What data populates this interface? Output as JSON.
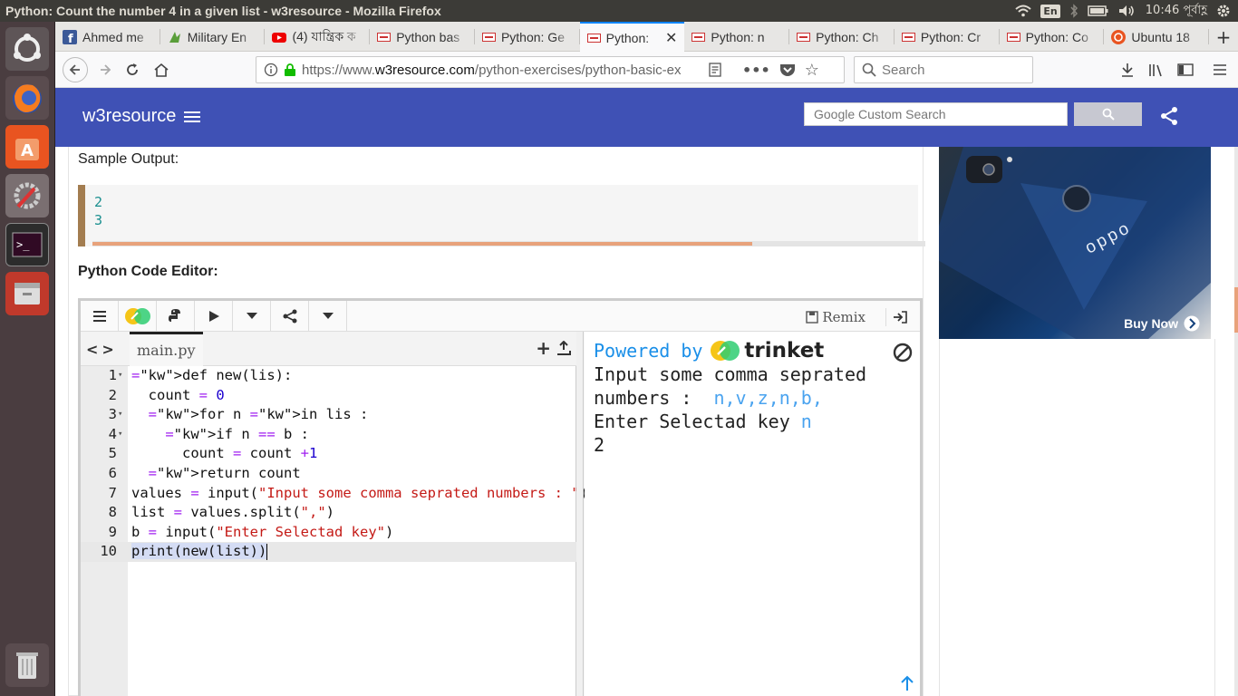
{
  "window": {
    "title": "Python: Count the number 4 in a given list - w3resource - Mozilla Firefox"
  },
  "tray": {
    "keyboard": "En",
    "time": "10:46 পূর্বাহ্ণ"
  },
  "tabs": [
    {
      "label": "Ahmed me",
      "favicon": "facebook-icon"
    },
    {
      "label": "Military En",
      "favicon": "leaf-icon"
    },
    {
      "label": "(4) যান্ত্রিক ক",
      "favicon": "youtube-icon"
    },
    {
      "label": "Python bas",
      "favicon": "w3resource-icon"
    },
    {
      "label": "Python: Ge",
      "favicon": "w3resource-icon"
    },
    {
      "label": "Python:",
      "favicon": "w3resource-icon",
      "active": true
    },
    {
      "label": "Python: n",
      "favicon": "w3resource-icon"
    },
    {
      "label": "Python: Ch",
      "favicon": "w3resource-icon"
    },
    {
      "label": "Python: Cr",
      "favicon": "w3resource-icon"
    },
    {
      "label": "Python: Co",
      "favicon": "w3resource-icon"
    },
    {
      "label": "Ubuntu 18",
      "favicon": "ubuntu-icon"
    }
  ],
  "navbar": {
    "url_prefix": "https://www.",
    "url_domain": "w3resource.com",
    "url_path": "/python-exercises/python-basic-ex",
    "search_placeholder": "Search"
  },
  "site": {
    "logo": "w3resource",
    "search_placeholder": "Google Custom Search"
  },
  "page": {
    "sample_output_label": "Sample Output:",
    "sample_output_lines": [
      "2",
      "3"
    ],
    "code_editor_label": "Python Code Editor:"
  },
  "trinket": {
    "remix_label": "Remix",
    "file_name": "main.py",
    "powered_by": "Powered by",
    "brand": "trinket",
    "code_lines": [
      {
        "n": "1",
        "text": "def new(lis):"
      },
      {
        "n": "2",
        "text": "  count = 0"
      },
      {
        "n": "3",
        "text": "  for n in lis :"
      },
      {
        "n": "4",
        "text": "    if n == b :"
      },
      {
        "n": "5",
        "text": "      count = count +1"
      },
      {
        "n": "6",
        "text": "  return count"
      },
      {
        "n": "7",
        "text": "values = input(\"Input some comma seprated numbers : \")"
      },
      {
        "n": "8",
        "text": "list = values.split(\",\")"
      },
      {
        "n": "9",
        "text": "b = input(\"Enter Selectad key\")"
      },
      {
        "n": "10",
        "text": "print(new(list))"
      }
    ],
    "output": {
      "line1": "Input some comma seprated",
      "line2_prompt": "numbers :  ",
      "line2_input": "n,v,z,n,b,",
      "line3_prompt": "Enter Selectad key ",
      "line3_input": "n",
      "line4": "2"
    }
  },
  "ad": {
    "brand": "oppo",
    "cta": "Buy Now"
  }
}
